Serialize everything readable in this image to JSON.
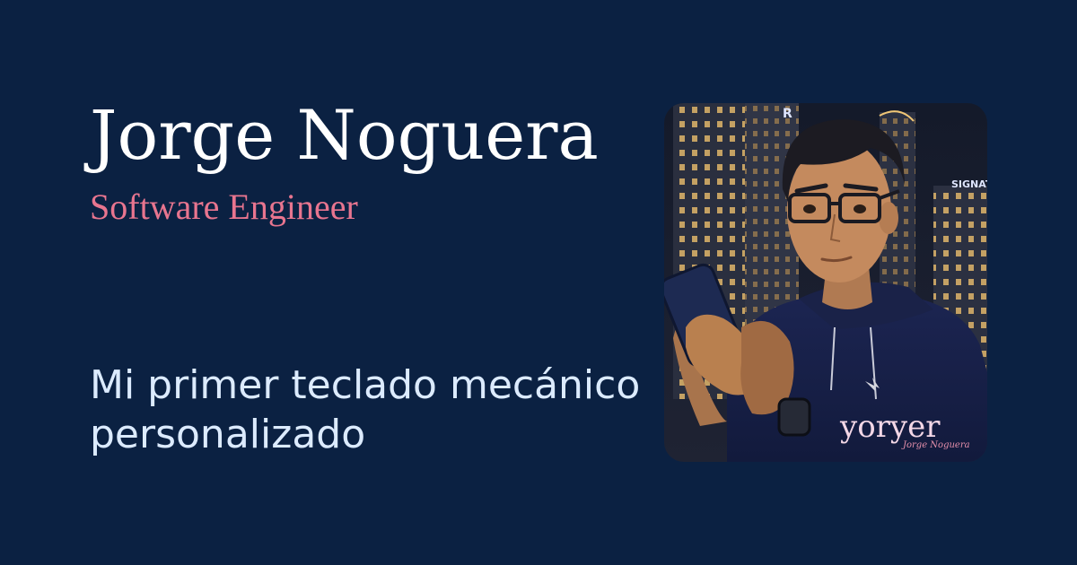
{
  "header": {
    "name": "Jorge Noguera",
    "role": "Software Engineer"
  },
  "post": {
    "title": "Mi primer teclado mecánico personalizado"
  },
  "avatar": {
    "sign_text": "SIGNATUR",
    "building_letter": "R",
    "watermark_main": "yoryer",
    "watermark_sub": "Jorge Noguera"
  },
  "colors": {
    "background": "#0b2142",
    "name": "#ffffff",
    "role": "#e8758f",
    "title": "#dcebff"
  }
}
